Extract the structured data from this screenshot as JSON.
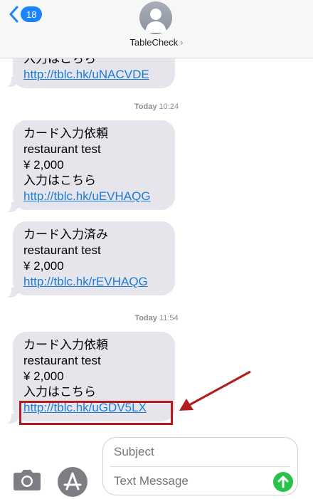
{
  "header": {
    "back_count": "18",
    "contact_name": "TableCheck",
    "contact_chevron": "›"
  },
  "messages": [
    {
      "lines": [
        "入力はこちら"
      ],
      "link": "http://tblc.hk/uNACVDE"
    },
    {
      "lines": [
        "カード入力依頼",
        "restaurant test",
        "¥ 2,000",
        "入力はこちら"
      ],
      "link": "http://tblc.hk/uEVHAQG"
    },
    {
      "lines": [
        "カード入力済み",
        "restaurant test",
        "¥ 2,000"
      ],
      "link": "http://tblc.hk/rEVHAQG"
    },
    {
      "lines": [
        "カード入力依頼",
        "restaurant test",
        "¥ 2,000",
        "入力はこちら"
      ],
      "link": "http://tblc.hk/uGDV5LX"
    }
  ],
  "timestamps": [
    {
      "day": "Today",
      "time": "10:24"
    },
    {
      "day": "Today",
      "time": "11:54"
    }
  ],
  "composer": {
    "subject_placeholder": "Subject",
    "message_placeholder": "Text Message"
  },
  "icons": {
    "back": "chevron-left-icon",
    "avatar": "person-icon",
    "camera": "camera-icon",
    "apps": "app-store-icon",
    "send": "arrow-up-icon"
  },
  "colors": {
    "accent": "#1a84ff",
    "bubble": "#e6e5eb",
    "link": "#1a7bd8",
    "annotation": "#b21c1c",
    "send": "#27c24a"
  }
}
